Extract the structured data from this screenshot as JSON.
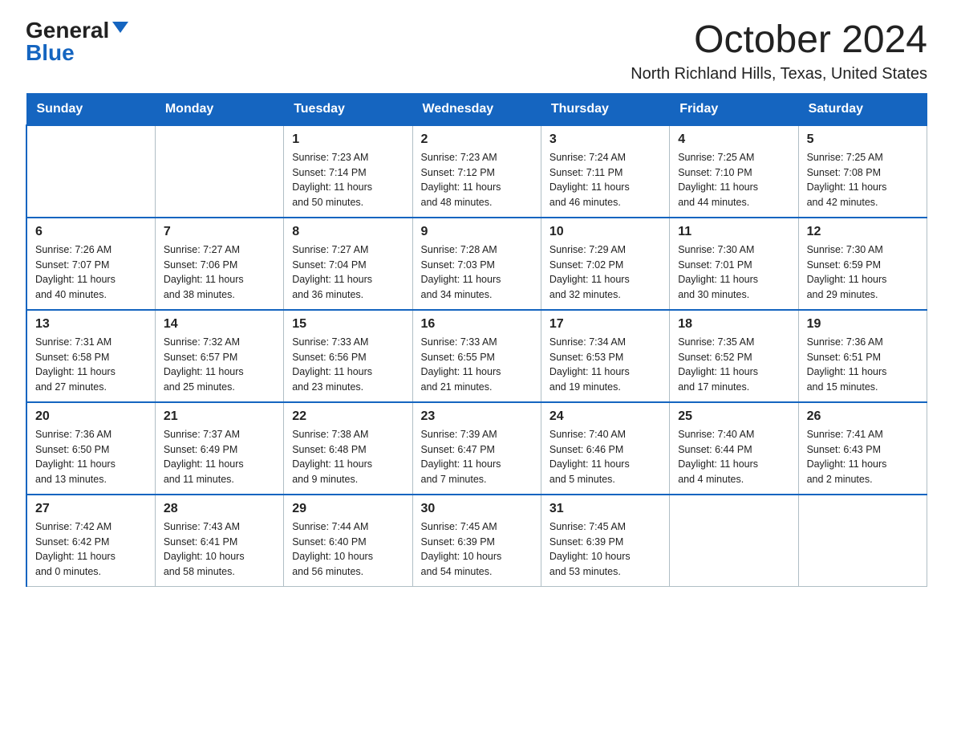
{
  "logo": {
    "general": "General",
    "blue": "Blue"
  },
  "title": "October 2024",
  "subtitle": "North Richland Hills, Texas, United States",
  "days_header": [
    "Sunday",
    "Monday",
    "Tuesday",
    "Wednesday",
    "Thursday",
    "Friday",
    "Saturday"
  ],
  "weeks": [
    [
      {
        "day": "",
        "info": ""
      },
      {
        "day": "",
        "info": ""
      },
      {
        "day": "1",
        "info": "Sunrise: 7:23 AM\nSunset: 7:14 PM\nDaylight: 11 hours\nand 50 minutes."
      },
      {
        "day": "2",
        "info": "Sunrise: 7:23 AM\nSunset: 7:12 PM\nDaylight: 11 hours\nand 48 minutes."
      },
      {
        "day": "3",
        "info": "Sunrise: 7:24 AM\nSunset: 7:11 PM\nDaylight: 11 hours\nand 46 minutes."
      },
      {
        "day": "4",
        "info": "Sunrise: 7:25 AM\nSunset: 7:10 PM\nDaylight: 11 hours\nand 44 minutes."
      },
      {
        "day": "5",
        "info": "Sunrise: 7:25 AM\nSunset: 7:08 PM\nDaylight: 11 hours\nand 42 minutes."
      }
    ],
    [
      {
        "day": "6",
        "info": "Sunrise: 7:26 AM\nSunset: 7:07 PM\nDaylight: 11 hours\nand 40 minutes."
      },
      {
        "day": "7",
        "info": "Sunrise: 7:27 AM\nSunset: 7:06 PM\nDaylight: 11 hours\nand 38 minutes."
      },
      {
        "day": "8",
        "info": "Sunrise: 7:27 AM\nSunset: 7:04 PM\nDaylight: 11 hours\nand 36 minutes."
      },
      {
        "day": "9",
        "info": "Sunrise: 7:28 AM\nSunset: 7:03 PM\nDaylight: 11 hours\nand 34 minutes."
      },
      {
        "day": "10",
        "info": "Sunrise: 7:29 AM\nSunset: 7:02 PM\nDaylight: 11 hours\nand 32 minutes."
      },
      {
        "day": "11",
        "info": "Sunrise: 7:30 AM\nSunset: 7:01 PM\nDaylight: 11 hours\nand 30 minutes."
      },
      {
        "day": "12",
        "info": "Sunrise: 7:30 AM\nSunset: 6:59 PM\nDaylight: 11 hours\nand 29 minutes."
      }
    ],
    [
      {
        "day": "13",
        "info": "Sunrise: 7:31 AM\nSunset: 6:58 PM\nDaylight: 11 hours\nand 27 minutes."
      },
      {
        "day": "14",
        "info": "Sunrise: 7:32 AM\nSunset: 6:57 PM\nDaylight: 11 hours\nand 25 minutes."
      },
      {
        "day": "15",
        "info": "Sunrise: 7:33 AM\nSunset: 6:56 PM\nDaylight: 11 hours\nand 23 minutes."
      },
      {
        "day": "16",
        "info": "Sunrise: 7:33 AM\nSunset: 6:55 PM\nDaylight: 11 hours\nand 21 minutes."
      },
      {
        "day": "17",
        "info": "Sunrise: 7:34 AM\nSunset: 6:53 PM\nDaylight: 11 hours\nand 19 minutes."
      },
      {
        "day": "18",
        "info": "Sunrise: 7:35 AM\nSunset: 6:52 PM\nDaylight: 11 hours\nand 17 minutes."
      },
      {
        "day": "19",
        "info": "Sunrise: 7:36 AM\nSunset: 6:51 PM\nDaylight: 11 hours\nand 15 minutes."
      }
    ],
    [
      {
        "day": "20",
        "info": "Sunrise: 7:36 AM\nSunset: 6:50 PM\nDaylight: 11 hours\nand 13 minutes."
      },
      {
        "day": "21",
        "info": "Sunrise: 7:37 AM\nSunset: 6:49 PM\nDaylight: 11 hours\nand 11 minutes."
      },
      {
        "day": "22",
        "info": "Sunrise: 7:38 AM\nSunset: 6:48 PM\nDaylight: 11 hours\nand 9 minutes."
      },
      {
        "day": "23",
        "info": "Sunrise: 7:39 AM\nSunset: 6:47 PM\nDaylight: 11 hours\nand 7 minutes."
      },
      {
        "day": "24",
        "info": "Sunrise: 7:40 AM\nSunset: 6:46 PM\nDaylight: 11 hours\nand 5 minutes."
      },
      {
        "day": "25",
        "info": "Sunrise: 7:40 AM\nSunset: 6:44 PM\nDaylight: 11 hours\nand 4 minutes."
      },
      {
        "day": "26",
        "info": "Sunrise: 7:41 AM\nSunset: 6:43 PM\nDaylight: 11 hours\nand 2 minutes."
      }
    ],
    [
      {
        "day": "27",
        "info": "Sunrise: 7:42 AM\nSunset: 6:42 PM\nDaylight: 11 hours\nand 0 minutes."
      },
      {
        "day": "28",
        "info": "Sunrise: 7:43 AM\nSunset: 6:41 PM\nDaylight: 10 hours\nand 58 minutes."
      },
      {
        "day": "29",
        "info": "Sunrise: 7:44 AM\nSunset: 6:40 PM\nDaylight: 10 hours\nand 56 minutes."
      },
      {
        "day": "30",
        "info": "Sunrise: 7:45 AM\nSunset: 6:39 PM\nDaylight: 10 hours\nand 54 minutes."
      },
      {
        "day": "31",
        "info": "Sunrise: 7:45 AM\nSunset: 6:39 PM\nDaylight: 10 hours\nand 53 minutes."
      },
      {
        "day": "",
        "info": ""
      },
      {
        "day": "",
        "info": ""
      }
    ]
  ]
}
